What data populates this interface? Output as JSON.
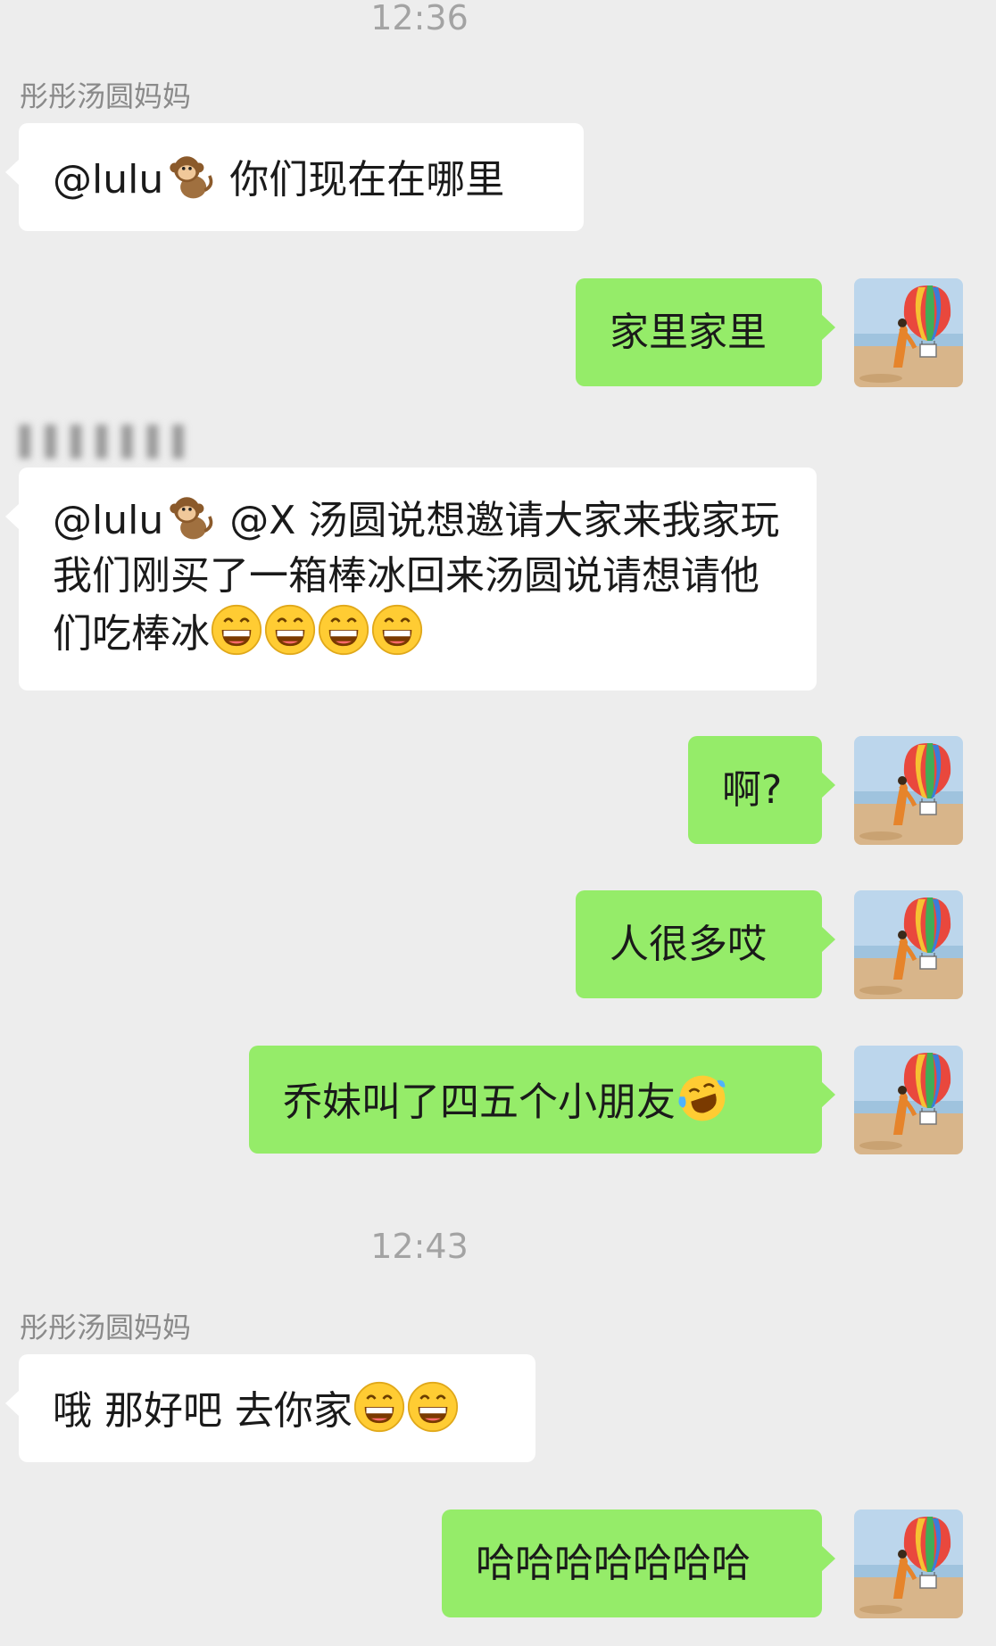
{
  "timestamps": [
    "12:36",
    "12:43"
  ],
  "senders": {
    "sender_1": "彤彤汤圆妈妈",
    "sender_2_blurred": "▌▌▌▌▌▌▌"
  },
  "messages": [
    {
      "side": "in",
      "parts": [
        "@lulu",
        "[monkey]",
        " 你们现在在哪里"
      ]
    },
    {
      "side": "out",
      "text": "家里家里"
    },
    {
      "side": "in",
      "parts": [
        "@lulu",
        "[monkey]",
        " @X 汤圆说想邀请大家来我家玩 我们刚买了一箱棒冰回来汤圆说请想请他们吃棒冰",
        "[grin]",
        "[grin]",
        "[grin]",
        "[grin]"
      ]
    },
    {
      "side": "out",
      "text": "啊?"
    },
    {
      "side": "out",
      "text": "人很多哎"
    },
    {
      "side": "out",
      "text": "乔妹叫了四五个小朋友"
    },
    {
      "side": "in",
      "text": "哦 那好吧 去你家"
    },
    {
      "side": "out",
      "text": "哈哈哈哈哈哈哈"
    }
  ],
  "text": {
    "m1_mention": "@lulu",
    "m1_body": " 你们现在在哪里",
    "m2": "家里家里",
    "m3_mention": "@lulu",
    "m3_body": " @X 汤圆说想邀请大家来我家玩 我们刚买了一箱棒冰回来汤圆说请想请他们吃棒冰",
    "m4": "啊?",
    "m5": "人很多哎",
    "m6": "乔妹叫了四五个小朋友",
    "m7": "哦 那好吧 去你家",
    "m8": "哈哈哈哈哈哈哈"
  },
  "icons": {
    "monkey": "monkey-emoji-icon",
    "grin": "grinning-face-emoji-icon",
    "laugh_cry": "rolling-laughing-emoji-icon",
    "avatar": "hot-air-balloon-avatar"
  },
  "colors": {
    "background": "#ededed",
    "incoming_bubble": "#ffffff",
    "outgoing_bubble": "#95ec69",
    "timestamp": "#a3a3a3",
    "sender_name": "#8a8a8a"
  }
}
